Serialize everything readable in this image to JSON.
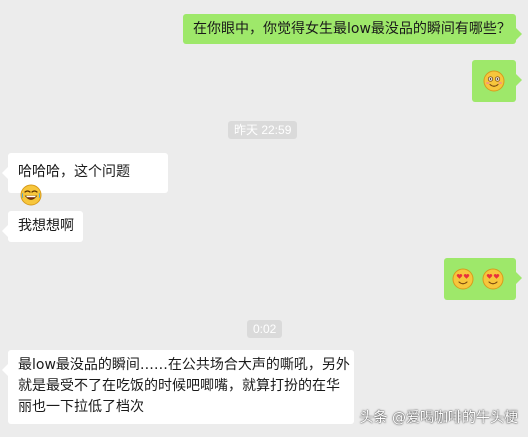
{
  "messages": {
    "m1": {
      "text": "在你眼中，你觉得女生最low最没品的瞬间有哪些？"
    },
    "m2": {
      "emoji": "smiling-grimace-emoji"
    },
    "time1": "昨天 22:59",
    "m3": {
      "text": "哈哈哈，这个问题",
      "emoji": "crying-laughing-emoji"
    },
    "m4": {
      "text": "我想想啊"
    },
    "m5": {
      "emoji": "heart-eyes-emoji"
    },
    "time2": "0:02",
    "m6": {
      "line1": "最low最没品的瞬间……在公共场合大声的嘶吼，另外",
      "line2": "就是最受不了在吃饭的时候吧唧嘴，就算打扮的在华",
      "line3": "丽也一下拉低了档次"
    }
  },
  "watermark": "头条 @爱喝咖啡的牛头梗",
  "colors": {
    "background": "#ececec",
    "outgoing_bubble": "#9ee86a",
    "incoming_bubble": "#ffffff",
    "timestamp_bg": "#dadada"
  }
}
